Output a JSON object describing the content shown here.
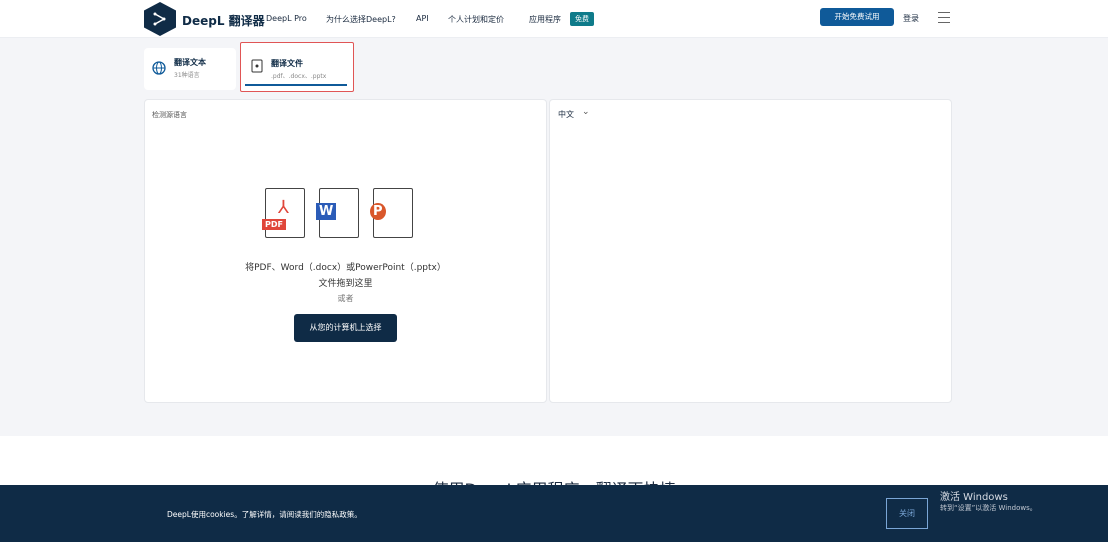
{
  "header": {
    "brand": "DeepL 翻译器",
    "nav": [
      "DeepL Pro",
      "为什么选择DeepL?",
      "API",
      "个人计划和定价",
      "应用程序"
    ],
    "badge": "免费",
    "trial_button": "开始免费试用",
    "login": "登录"
  },
  "tabs": [
    {
      "title": "翻译文本",
      "subtitle": "31种语言"
    },
    {
      "title": "翻译文件",
      "subtitle": ".pdf、.docx、.pptx"
    }
  ],
  "source": {
    "label": "检测源语言",
    "file_types": [
      "PDF",
      "W",
      "P"
    ],
    "drop_text": "将PDF、Word（.docx）或PowerPoint（.pptx）",
    "drop_text2": "文件拖到这里",
    "or": "或者",
    "select_button": "从您的计算机上选择"
  },
  "target": {
    "language": "中文"
  },
  "promo": {
    "heading": "使用DeepL应用程序，翻译更快捷"
  },
  "cookie": {
    "text": "DeepL使用cookies。了解详情，请阅读我们的隐私政策。",
    "close": "关闭"
  },
  "watermark": {
    "title": "激活 Windows",
    "subtitle": "转到“设置”以激活 Windows。"
  },
  "colors": {
    "navy": "#0f2b46",
    "accent": "#0f5a99",
    "highlight": "#e05555"
  }
}
